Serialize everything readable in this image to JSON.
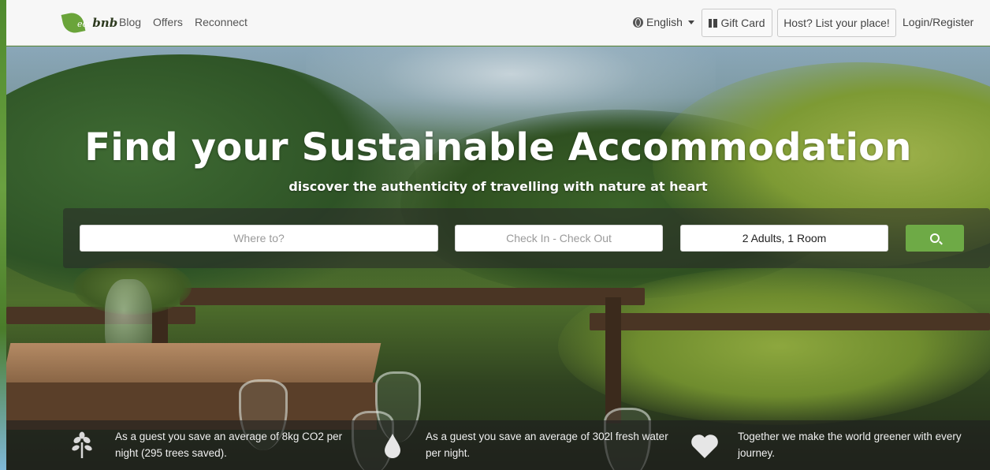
{
  "navbar": {
    "logo_text": "bnb",
    "logo_prefix": "eco",
    "links": [
      "Blog",
      "Offers",
      "Reconnect"
    ],
    "language": "English",
    "gift_card": "Gift Card",
    "host": "Host? List your place!",
    "login": "Login/Register"
  },
  "hero": {
    "title": "Find your Sustainable Accommodation",
    "subtitle": "discover the authenticity of travelling with nature at heart"
  },
  "search": {
    "where_placeholder": "Where to?",
    "dates_placeholder": "Check In - Check Out",
    "guests_value": "2 Adults, 1 Room"
  },
  "stats": [
    {
      "icon": "sprout-icon",
      "text": "As a guest you save an average of 8kg CO2 per night (295 trees saved)."
    },
    {
      "icon": "water-drop-icon",
      "text": "As a guest you save an average of 302l fresh water per night."
    },
    {
      "icon": "heart-icon",
      "text": "Together we make the world greener with every journey."
    }
  ],
  "colors": {
    "accent_green": "#6eaa46",
    "navbar_bg": "#f7f7f7"
  }
}
